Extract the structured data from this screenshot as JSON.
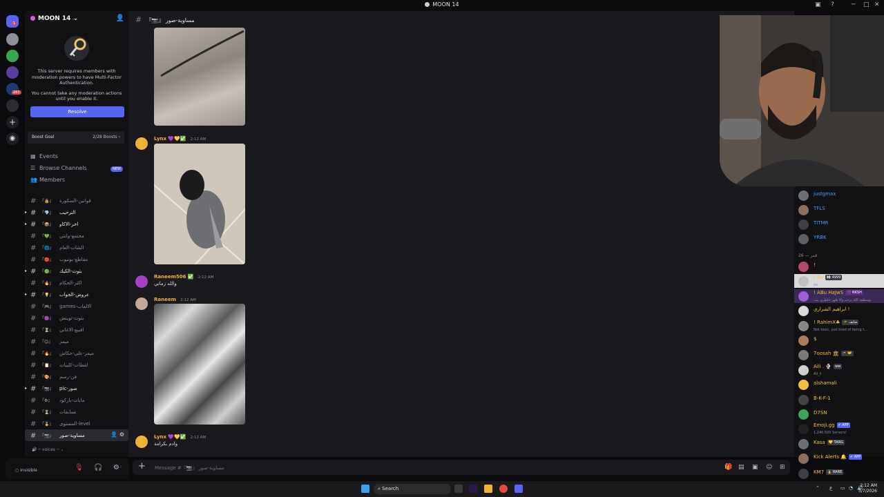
{
  "window": {
    "title": "MOON 14"
  },
  "server": {
    "name": "MOON 14",
    "mfa_line1": "This server requires members with moderation powers to have Multi-Factor Authentication.",
    "mfa_line2": "You cannot take any moderation actions until you enable it.",
    "resolve_label": "Resolve",
    "boost_label": "Boost Goal",
    "boost_count": "2/28 Boosts",
    "badges": [
      "1",
      "247"
    ]
  },
  "nav": {
    "events": "Events",
    "browse": "Browse Channels",
    "browse_badge": "NEW",
    "members": "Members"
  },
  "channels": [
    {
      "emoji": "『🔒』",
      "name": "قوانين-السكورة"
    },
    {
      "emoji": "『💎』",
      "name": "الترحيب"
    },
    {
      "emoji": "『📦』",
      "name": "اخر-الاكاو"
    },
    {
      "emoji": "『💚』",
      "name": "مجتمع-وانتي"
    },
    {
      "emoji": "『🌐』",
      "name": "الشات-العام"
    },
    {
      "emoji": "『🔴』",
      "name": "مقاطع-يوتيوب"
    },
    {
      "emoji": "『🟢』",
      "name": "بثوث-الكيك"
    },
    {
      "emoji": "『🔥』",
      "name": "اكثر-الحكام"
    },
    {
      "emoji": "『💡』",
      "name": "عروض-الجواب"
    },
    {
      "emoji": "『🎮』",
      "name": "games-الالعاب"
    },
    {
      "emoji": "『🟣』",
      "name": "بثوث-تويتش"
    },
    {
      "emoji": "『⏳』",
      "name": "افيبع-الاغاني"
    },
    {
      "emoji": "『😊』",
      "name": "ميمز"
    },
    {
      "emoji": "『🔥』",
      "name": "ميمز-على-حكاش"
    },
    {
      "emoji": "『📋』",
      "name": "لقطات-كليبات"
    },
    {
      "emoji": "『🎨』",
      "name": "فن-رسم"
    },
    {
      "emoji": "『📷』",
      "name": "pic-صور"
    },
    {
      "emoji": "『⚙』",
      "name": "مابات-باركود"
    },
    {
      "emoji": "『⌛』",
      "name": "نسابقات"
    },
    {
      "emoji": "『🏅』",
      "name": "المستوى-level"
    },
    {
      "emoji": "『📷』",
      "name": "مساوية-صور"
    }
  ],
  "voices_label": "─ voices ─",
  "user": {
    "status": "Invisible"
  },
  "chat": {
    "channel_name": "『📷』 مساوية-صور",
    "composer_placeholder": "Message #『📷』 مساوية-صور",
    "messages": [
      {
        "author": "Lynx",
        "badges": "💜💛✅",
        "time": "2:12 AM",
        "text": ""
      },
      {
        "author": "Raneem506",
        "badges": "✅",
        "time": "2:12 AM",
        "text": "والله زماني"
      },
      {
        "author": "Raneem",
        "badges": "",
        "time": "2:12 AM",
        "text": ""
      },
      {
        "author": "Lynx",
        "badges": "💜💛✅",
        "time": "2:12 AM",
        "text": "وادم بكرامة"
      }
    ]
  },
  "member_list": {
    "group_label": "قمر — 26",
    "top": [
      {
        "name": "justgmax",
        "color": "#4f9bf5"
      },
      {
        "name": "TFLS",
        "color": "#4f9bf5"
      },
      {
        "name": "TITMR",
        "color": "#4f9bf5"
      },
      {
        "name": "YRBK",
        "color": "#4f9bf5"
      }
    ],
    "members": [
      {
        "name": "!",
        "sub": "",
        "color": "#f0c040",
        "tag": "",
        "tag_color": ""
      },
      {
        "name": "! Ro",
        "sub": "av",
        "color": "#f0c040",
        "tag": "👀 4999",
        "tag_color": "#3a3c43"
      },
      {
        "name": "! ABu HaJwS",
        "sub": "بومنطقه الله يرحم والا ظهر خاطري بيت",
        "color": "#f0c040",
        "tag": "🏹 NKSH",
        "tag_color": "#5b2a86"
      },
      {
        "name": "ابراهيم الشراري !",
        "sub": "",
        "color": "#f0c040",
        "tag": "",
        "tag_color": ""
      },
      {
        "name": "! RahimX♣",
        "sub": "Not toxic, just tired of being t...",
        "color": "#f0c040",
        "tag": "🥷 شايف",
        "tag_color": "#3a3c43"
      },
      {
        "name": "$",
        "sub": "",
        "color": "#f0c040",
        "tag": "",
        "tag_color": ""
      },
      {
        "name": "7oosah 🏛",
        "sub": "",
        "color": "#f0c040",
        "tag": "🥷 🤝",
        "tag_color": "#3a3c43"
      },
      {
        "name": "Aili . 🍨",
        "sub": "Ali_li",
        "color": "#f0c040",
        "tag": "ww",
        "tag_color": "#3a3c43"
      },
      {
        "name": "alshamali",
        "sub": "",
        "color": "#f0c040",
        "tag": "",
        "tag_color": ""
      },
      {
        "name": "B-K-F-1",
        "sub": "",
        "color": "#f0c040",
        "tag": "",
        "tag_color": ""
      },
      {
        "name": "D7SN",
        "sub": "",
        "color": "#f0c040",
        "tag": "",
        "tag_color": ""
      },
      {
        "name": "Emoji.gg",
        "sub": "1,240,500 Servers!",
        "color": "#f0c040",
        "tag": "✔ APP",
        "tag_color": "#5865f2"
      },
      {
        "name": "Kasa",
        "sub": "",
        "color": "#f0c040",
        "tag": "💛 TARG",
        "tag_color": "#3a3c43"
      },
      {
        "name": "Kick Alerts 🔔",
        "sub": "",
        "color": "#f0c040",
        "tag": "✔ APP",
        "tag_color": "#5865f2"
      },
      {
        "name": "KM7",
        "sub": "",
        "color": "#f0c040",
        "tag": "🏅 RARE",
        "tag_color": "#3a3c43"
      }
    ]
  },
  "taskbar": {
    "search_label": "Search",
    "time": "2:12 AM",
    "date": "3/7/2026",
    "lang": "ع"
  },
  "colors": {
    "accent": "#5865f2",
    "sidebar": "#121214",
    "chat_bg": "#1a1a1e"
  }
}
